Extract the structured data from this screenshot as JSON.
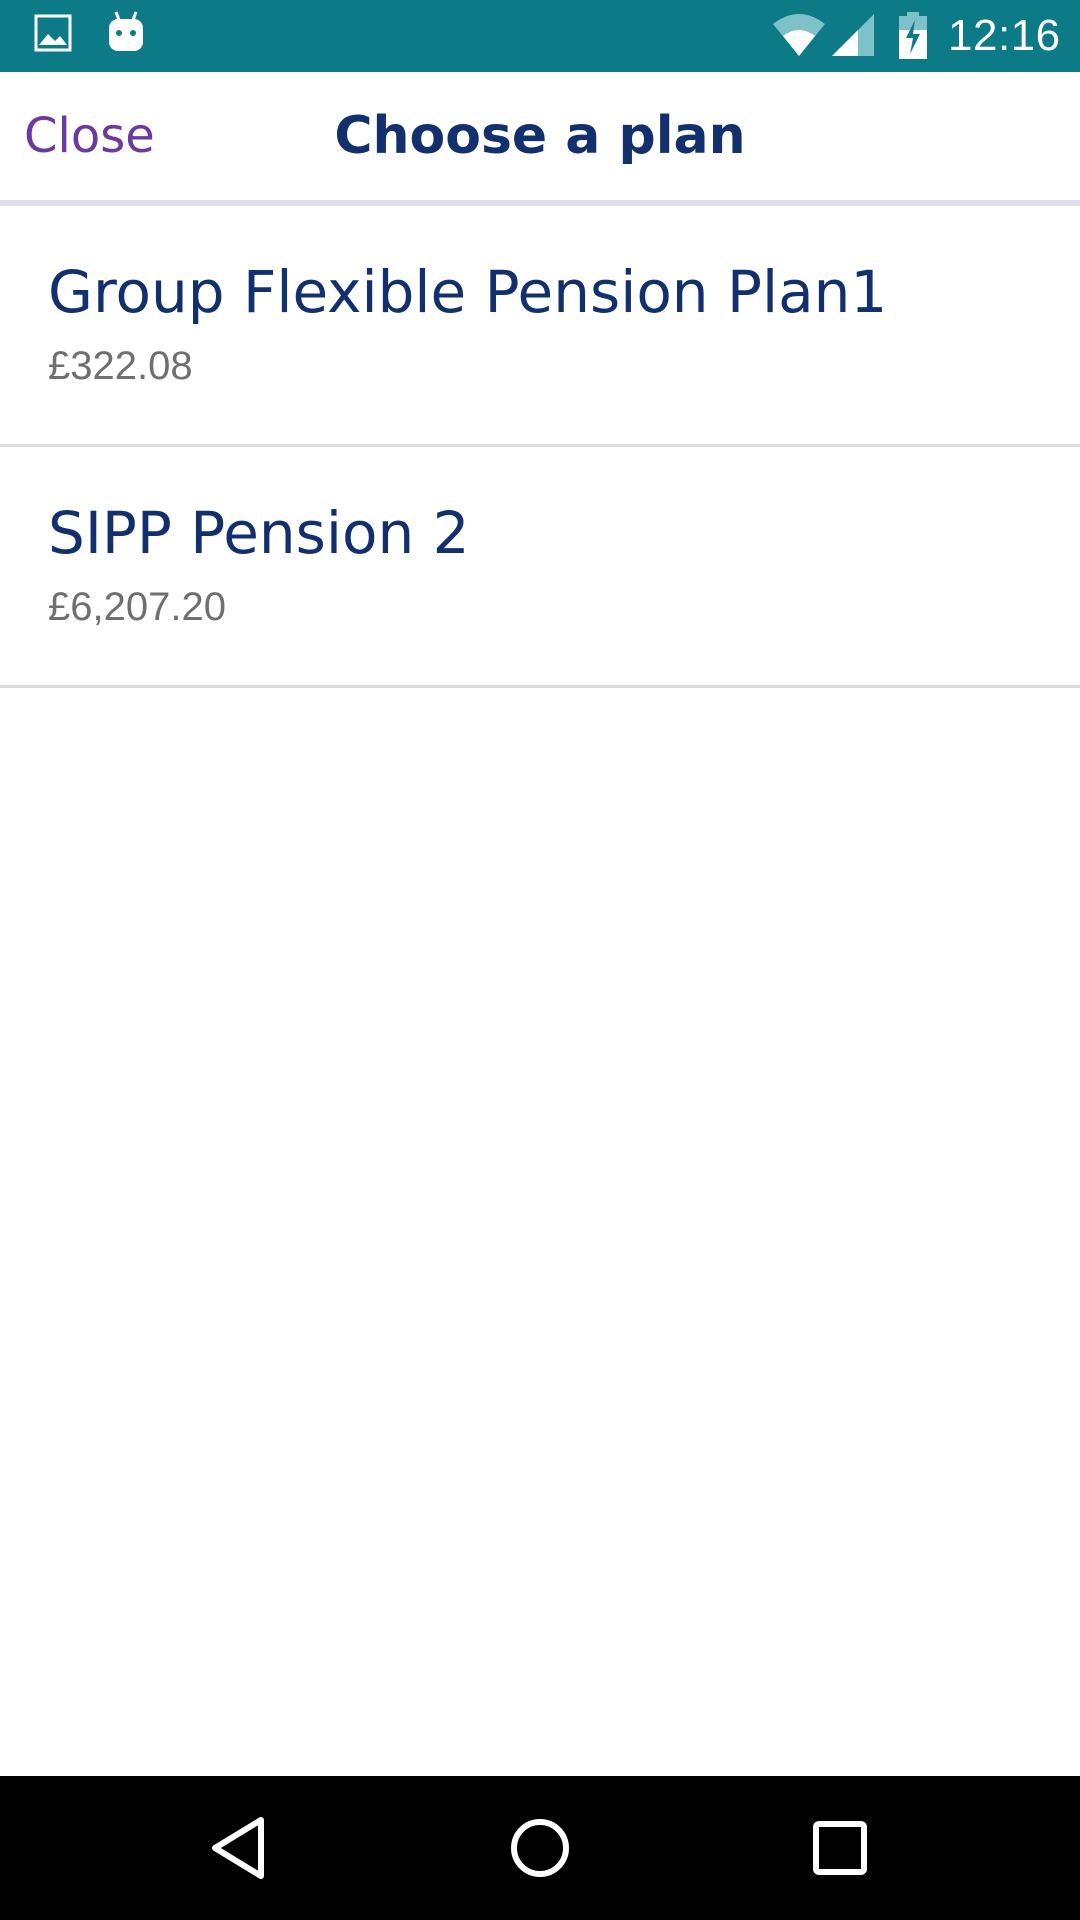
{
  "status_bar": {
    "time": "12:16",
    "color": "#0c7b87",
    "icons": [
      "gallery-icon",
      "android-icon",
      "wifi-icon",
      "signal-icon",
      "battery-charging-icon"
    ]
  },
  "header": {
    "close_label": "Close",
    "title": "Choose a plan"
  },
  "plans": [
    {
      "name": "Group Flexible Pension Plan1",
      "value": "£322.08"
    },
    {
      "name": "SIPP Pension 2",
      "value": "£6,207.20"
    }
  ],
  "colors": {
    "title": "#13306e",
    "close": "#6b3aa0",
    "value": "#6f6f6f"
  },
  "nav_bar": {
    "icons": [
      "back-icon",
      "home-icon",
      "recents-icon"
    ]
  }
}
